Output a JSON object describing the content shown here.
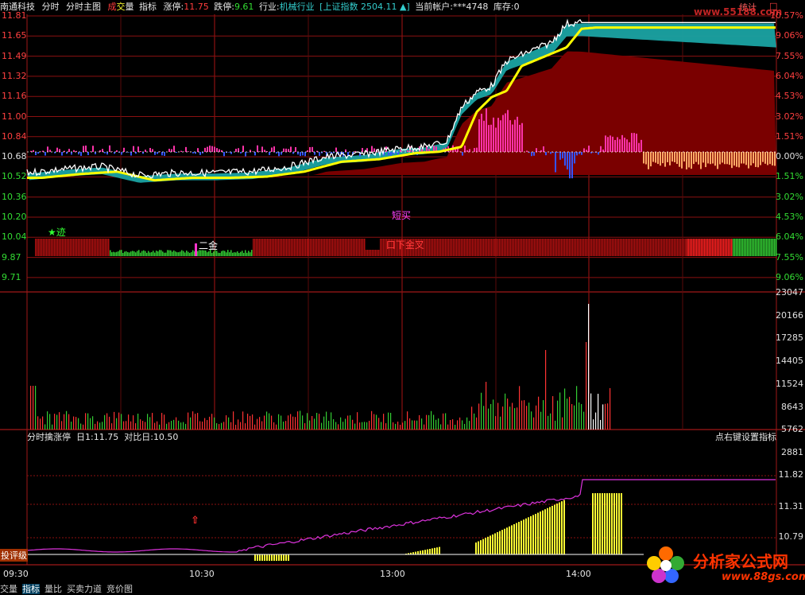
{
  "topbar": {
    "stock_name": "南通科技",
    "mode": "分时",
    "main_chart": "分时主图",
    "vol_part1": "成",
    "vol_part2": "交",
    "vol_part3": "量",
    "indicator": "指标",
    "limit_up_label": "涨停:",
    "limit_up": "11.75",
    "limit_down_label": "跌停:",
    "limit_down": "9.61",
    "industry_label": "行业:",
    "industry": "机械行业",
    "index_name": "[上证指数",
    "index_value": "2504.11",
    "index_arrow": "▲]",
    "account_label": "当前帐户:",
    "account": "***4748",
    "stock_label": "库存:",
    "stock": "0",
    "stats": "统计",
    "site": "www.55188.com",
    "max_icon": "□"
  },
  "price_axis": [
    "11.81",
    "11.65",
    "11.49",
    "11.32",
    "11.16",
    "11.00",
    "10.84",
    "10.68",
    "10.52",
    "10.36",
    "10.20",
    "10.04",
    "9.87",
    "9.71"
  ],
  "pct_axis": [
    "10.57%",
    "9.06%",
    "7.55%",
    "6.04%",
    "4.53%",
    "3.02%",
    "1.51%",
    "0.00%",
    "1.51%",
    "3.02%",
    "4.53%",
    "6.04%",
    "7.55%",
    "9.06%"
  ],
  "annotations": {
    "star": "★迹",
    "erjin": "二金",
    "duanmai": "短买",
    "kaipan": "口下金叉"
  },
  "vol_axis": [
    "23047",
    "20166",
    "17285",
    "14405",
    "11524",
    "8643",
    "5762",
    "2881"
  ],
  "sub_panel": {
    "title": "分时擒涨停",
    "day_label": "日1:",
    "day_value": "11.75",
    "ratio_label": "对比日:",
    "ratio_value": "10.50",
    "hint": "点右键设置指标",
    "axis": [
      "11.82",
      "11.31",
      "10.79"
    ],
    "rating_btn": "投评级"
  },
  "time_axis": [
    "09:30",
    "10:30",
    "13:00",
    "14:00"
  ],
  "tabs": [
    "交量",
    "指标",
    "量比",
    "买卖力道",
    "竞价图"
  ],
  "watermark": {
    "title": "分析家公式网",
    "url": "www.88gs.com"
  },
  "colors": {
    "up": "#ff3c3c",
    "down": "#33dd33",
    "price_line": "#ffffff",
    "avg_line": "#ffff00",
    "band": "#1aa3a3",
    "band_dark": "#7a0000"
  }
}
